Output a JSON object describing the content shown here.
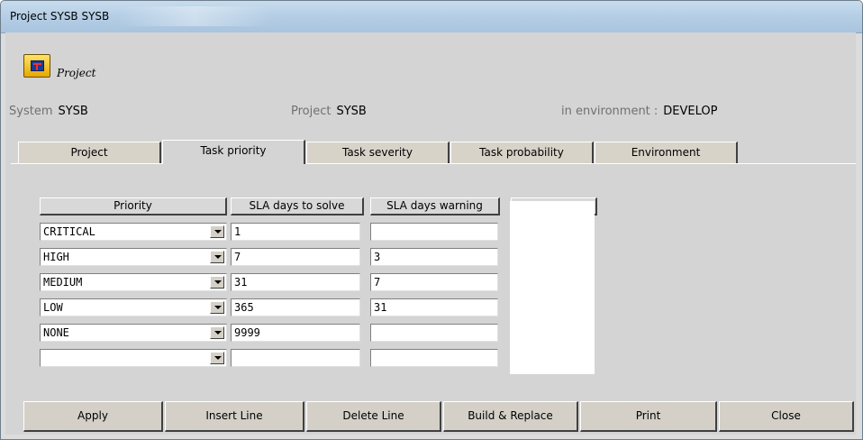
{
  "window": {
    "title": "Project SYSB SYSB"
  },
  "header": {
    "caption": "Project",
    "system_label": "System",
    "system_value": "SYSB",
    "project_label": "Project",
    "project_value": "SYSB",
    "env_label": "in environment :",
    "env_value": "DEVELOP"
  },
  "tabs": [
    {
      "label": "Project",
      "active": false
    },
    {
      "label": "Task priority",
      "active": true
    },
    {
      "label": "Task severity",
      "active": false
    },
    {
      "label": "Task probability",
      "active": false
    },
    {
      "label": "Environment",
      "active": false
    }
  ],
  "grid": {
    "columns": [
      "Priority",
      "SLA days to solve",
      "SLA days warning"
    ],
    "rows": [
      {
        "priority": "CRITICAL",
        "sla_solve": "1",
        "sla_warning": ""
      },
      {
        "priority": "HIGH",
        "sla_solve": "7",
        "sla_warning": "3"
      },
      {
        "priority": "MEDIUM",
        "sla_solve": "31",
        "sla_warning": "7"
      },
      {
        "priority": "LOW",
        "sla_solve": "365",
        "sla_warning": "31"
      },
      {
        "priority": "NONE",
        "sla_solve": "9999",
        "sla_warning": ""
      },
      {
        "priority": "",
        "sla_solve": "",
        "sla_warning": ""
      }
    ]
  },
  "buttons": {
    "apply": "Apply",
    "insert_line": "Insert Line",
    "delete_line": "Delete Line",
    "build_replace": "Build & Replace",
    "print": "Print",
    "close": "Close"
  }
}
